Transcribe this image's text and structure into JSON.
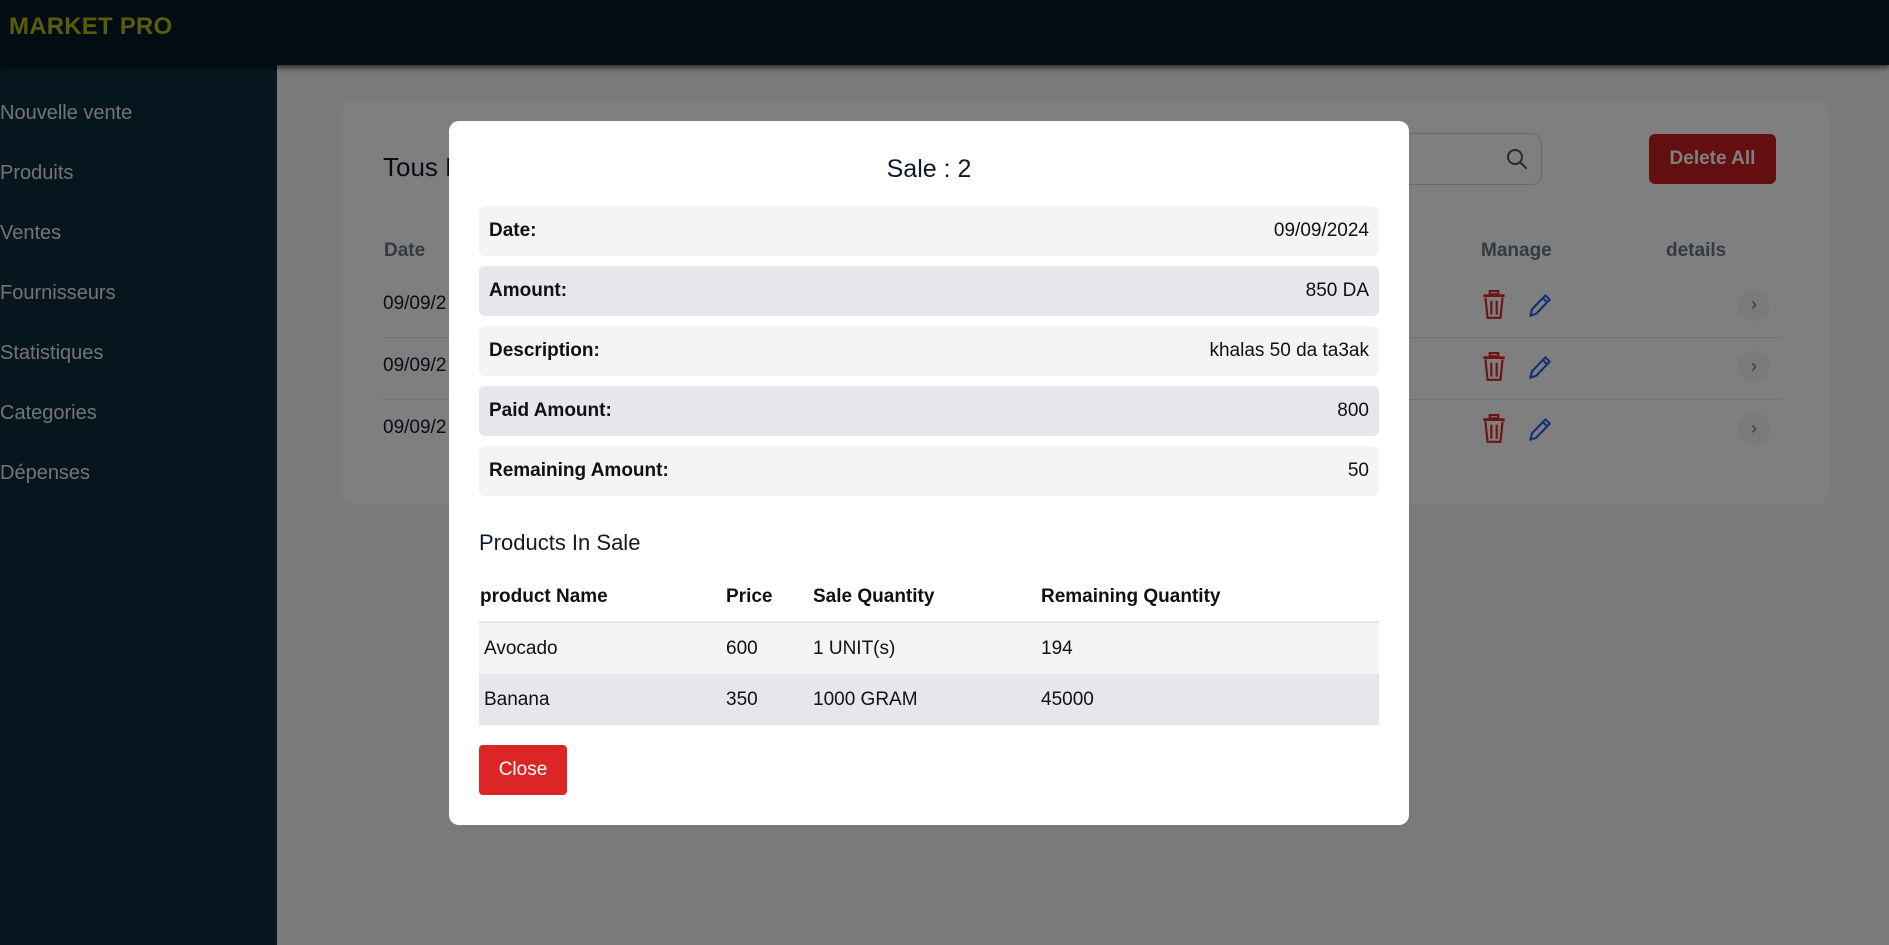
{
  "app": {
    "brand": "MARKET PRO"
  },
  "sidebar": {
    "items": [
      {
        "label": "Nouvelle vente"
      },
      {
        "label": "Produits"
      },
      {
        "label": "Ventes"
      },
      {
        "label": "Fournisseurs"
      },
      {
        "label": "Statistiques"
      },
      {
        "label": "Categories"
      },
      {
        "label": "Dépenses"
      }
    ]
  },
  "sales_panel": {
    "title": "Tous L",
    "delete_all_label": "Delete All",
    "columns": {
      "date": "Date",
      "manage": "Manage",
      "details": "details"
    },
    "rows": [
      {
        "date": "09/09/2"
      },
      {
        "date": "09/09/2"
      },
      {
        "date": "09/09/2"
      }
    ]
  },
  "modal": {
    "title": "Sale : 2",
    "fields": [
      {
        "label": "Date:",
        "value": "09/09/2024"
      },
      {
        "label": "Amount:",
        "value": "850 DA"
      },
      {
        "label": "Description:",
        "value": "khalas 50 da ta3ak"
      },
      {
        "label": "Paid Amount:",
        "value": "800"
      },
      {
        "label": "Remaining Amount:",
        "value": "50"
      }
    ],
    "products_title": "Products In Sale",
    "product_columns": {
      "name": "product Name",
      "price": "Price",
      "sale_qty": "Sale Quantity",
      "remaining_qty": "Remaining Quantity"
    },
    "products": [
      {
        "name": "Avocado",
        "price": "600",
        "sale_qty": "1 UNIT(s)",
        "remaining_qty": "194"
      },
      {
        "name": "Banana",
        "price": "350",
        "sale_qty": "1000 GRAM",
        "remaining_qty": "45000"
      }
    ],
    "close_label": "Close"
  },
  "colors": {
    "topbar": "#031826",
    "brand": "#b7b815",
    "sidebar": "#0f2d3c",
    "danger": "#dc2626",
    "edit": "#2563eb"
  },
  "icons": {
    "search": "search-icon",
    "delete": "trash-icon",
    "edit": "pencil-icon",
    "details": "chevron-right-icon"
  }
}
